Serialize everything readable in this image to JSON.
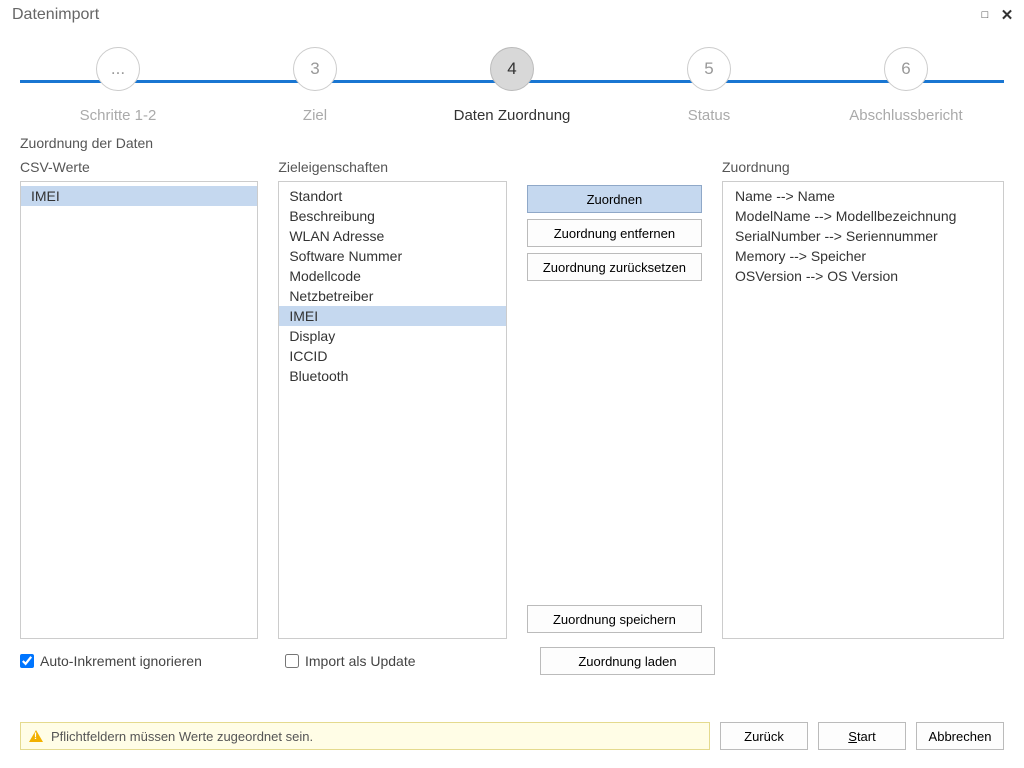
{
  "window": {
    "title": "Datenimport"
  },
  "stepper": [
    {
      "num": "...",
      "label": "Schritte 1-2",
      "current": false
    },
    {
      "num": "3",
      "label": "Ziel",
      "current": false
    },
    {
      "num": "4",
      "label": "Daten Zuordnung",
      "current": true
    },
    {
      "num": "5",
      "label": "Status",
      "current": false
    },
    {
      "num": "6",
      "label": "Abschlussbericht",
      "current": false
    }
  ],
  "subtitle": "Zuordnung der Daten",
  "headers": {
    "csv": "CSV-Werte",
    "target": "Zieleigenschaften",
    "mapping": "Zuordnung"
  },
  "csv_values": [
    {
      "label": "IMEI",
      "selected": true
    }
  ],
  "target_props": [
    {
      "label": "Standort"
    },
    {
      "label": "Beschreibung"
    },
    {
      "label": "WLAN Adresse"
    },
    {
      "label": "Software Nummer"
    },
    {
      "label": "Modellcode"
    },
    {
      "label": "Netzbetreiber"
    },
    {
      "label": "IMEI",
      "selected": true
    },
    {
      "label": "Display"
    },
    {
      "label": "ICCID"
    },
    {
      "label": "Bluetooth"
    }
  ],
  "action_buttons": {
    "map": "Zuordnen",
    "unmap": "Zuordnung entfernen",
    "reset": "Zuordnung zurücksetzen",
    "save": "Zuordnung speichern",
    "load": "Zuordnung laden"
  },
  "mappings": [
    "Name --> Name",
    "ModelName --> Modellbezeichnung",
    "SerialNumber --> Seriennummer",
    "Memory --> Speicher",
    "OSVersion --> OS Version"
  ],
  "checkboxes": {
    "auto_increment": {
      "label": "Auto-Inkrement ignorieren",
      "checked": true
    },
    "import_update": {
      "label": "Import als Update",
      "checked": false
    }
  },
  "message": "Pflichtfeldern müssen Werte zugeordnet sein.",
  "footer": {
    "back": "Zurück",
    "start_pre": "",
    "start_u": "S",
    "start_post": "tart",
    "cancel": "Abbrechen"
  }
}
